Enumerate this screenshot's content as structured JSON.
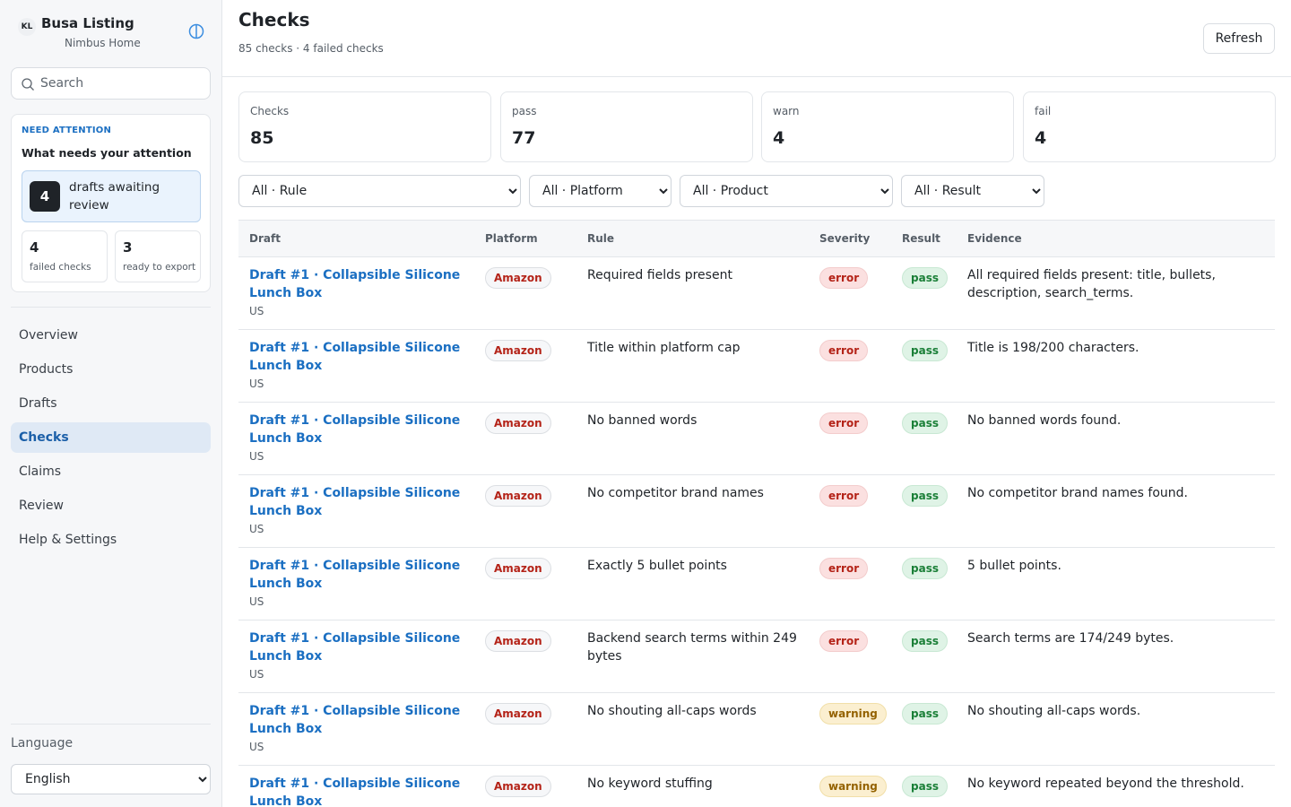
{
  "sidebar": {
    "brand_logo": "KL",
    "brand_title": "Busa Listing",
    "brand_subtitle": "Nimbus Home",
    "search_placeholder": "Search",
    "attention": {
      "eyebrow": "NEED ATTENTION",
      "title": "What needs your attention",
      "primary_count": "4",
      "primary_label": "drafts awaiting review",
      "cards": [
        {
          "count": "4",
          "label": "failed checks"
        },
        {
          "count": "3",
          "label": "ready to export"
        }
      ]
    },
    "nav": [
      "Overview",
      "Products",
      "Drafts",
      "Checks",
      "Claims",
      "Review",
      "Help & Settings"
    ],
    "active_nav": "Checks",
    "language_label": "Language",
    "language_value": "English"
  },
  "header": {
    "title": "Checks",
    "subtitle": "85 checks · 4 failed checks",
    "refresh_label": "Refresh"
  },
  "stats": [
    {
      "label": "Checks",
      "value": "85"
    },
    {
      "label": "pass",
      "value": "77"
    },
    {
      "label": "warn",
      "value": "4"
    },
    {
      "label": "fail",
      "value": "4"
    }
  ],
  "filters": {
    "rule": "All · Rule",
    "platform": "All · Platform",
    "product": "All · Product",
    "result": "All · Result"
  },
  "table": {
    "columns": [
      "Draft",
      "Platform",
      "Rule",
      "Severity",
      "Result",
      "Evidence"
    ],
    "rows": [
      {
        "draft": "Draft #1 · Collapsible Silicone Lunch Box",
        "market": "US",
        "platform": "Amazon",
        "rule": "Required fields present",
        "severity": "error",
        "result": "pass",
        "evidence": "All required fields present: title, bullets, description, search_terms."
      },
      {
        "draft": "Draft #1 · Collapsible Silicone Lunch Box",
        "market": "US",
        "platform": "Amazon",
        "rule": "Title within platform cap",
        "severity": "error",
        "result": "pass",
        "evidence": "Title is 198/200 characters."
      },
      {
        "draft": "Draft #1 · Collapsible Silicone Lunch Box",
        "market": "US",
        "platform": "Amazon",
        "rule": "No banned words",
        "severity": "error",
        "result": "pass",
        "evidence": "No banned words found."
      },
      {
        "draft": "Draft #1 · Collapsible Silicone Lunch Box",
        "market": "US",
        "platform": "Amazon",
        "rule": "No competitor brand names",
        "severity": "error",
        "result": "pass",
        "evidence": "No competitor brand names found."
      },
      {
        "draft": "Draft #1 · Collapsible Silicone Lunch Box",
        "market": "US",
        "platform": "Amazon",
        "rule": "Exactly 5 bullet points",
        "severity": "error",
        "result": "pass",
        "evidence": "5 bullet points."
      },
      {
        "draft": "Draft #1 · Collapsible Silicone Lunch Box",
        "market": "US",
        "platform": "Amazon",
        "rule": "Backend search terms within 249 bytes",
        "severity": "error",
        "result": "pass",
        "evidence": "Search terms are 174/249 bytes."
      },
      {
        "draft": "Draft #1 · Collapsible Silicone Lunch Box",
        "market": "US",
        "platform": "Amazon",
        "rule": "No shouting all-caps words",
        "severity": "warning",
        "result": "pass",
        "evidence": "No shouting all-caps words."
      },
      {
        "draft": "Draft #1 · Collapsible Silicone Lunch Box",
        "market": "US",
        "platform": "Amazon",
        "rule": "No keyword stuffing",
        "severity": "warning",
        "result": "pass",
        "evidence": "No keyword repeated beyond the threshold."
      }
    ]
  },
  "colors": {
    "accent": "#1b6fc2",
    "error": "#b42318",
    "warning": "#946200",
    "pass": "#1a7f37"
  }
}
